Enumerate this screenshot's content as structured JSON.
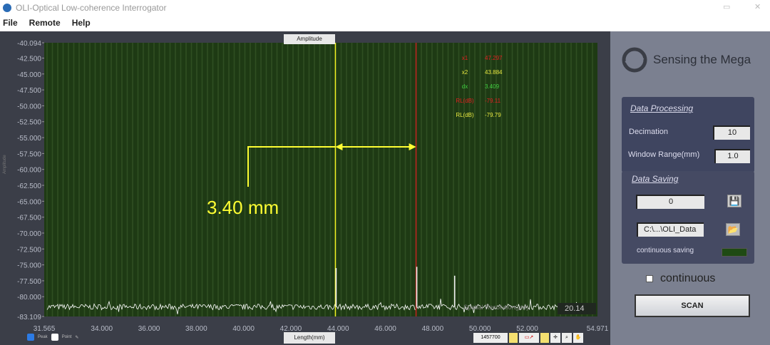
{
  "window": {
    "title": "OLI-Optical Low-coherence Interrogator",
    "minimize": "▭",
    "close": "✕"
  },
  "menu": [
    "File",
    "Remote",
    "Help"
  ],
  "plot": {
    "top_tab": "Amplitude",
    "bottom_tab": "Length(mm)",
    "y_side_label": "Amplitude",
    "legend": [
      {
        "label": "Peak",
        "checked": true
      },
      {
        "label": "Point",
        "checked": false
      }
    ],
    "toolbar_value": "1457700",
    "spatial_label": "Spatial Resolution(µm)",
    "spatial_value": "20.14",
    "annotation": "3.40 mm",
    "readouts": [
      {
        "key": "x1",
        "value": "47.297",
        "color": "#e02020"
      },
      {
        "key": "x2",
        "value": "43.884",
        "color": "#e8e840"
      },
      {
        "key": "dx",
        "value": "3.409",
        "color": "#40d040"
      },
      {
        "key": "RL(dB)",
        "value": "-79.11",
        "color": "#e02020"
      },
      {
        "key": "RL(dB)",
        "value": "-79.79",
        "color": "#e8e840"
      }
    ]
  },
  "chart_data": {
    "type": "line",
    "xlabel": "Length(mm)",
    "ylabel": "Amplitude",
    "xlim": [
      31.565,
      54.971
    ],
    "ylim": [
      -83.109,
      -40.094
    ],
    "x_ticks": [
      "31.565",
      "34.000",
      "36.000",
      "38.000",
      "40.000",
      "42.000",
      "44.000",
      "46.000",
      "48.000",
      "50.000",
      "52.000",
      "54.971"
    ],
    "y_ticks": [
      "-40.094",
      "-42.500",
      "-45.000",
      "-47.500",
      "-50.000",
      "-52.500",
      "-55.000",
      "-57.500",
      "-60.000",
      "-62.500",
      "-65.000",
      "-67.500",
      "-70.000",
      "-72.500",
      "-75.000",
      "-77.500",
      "-80.000",
      "-83.109"
    ],
    "noise_floor": -81.6,
    "peaks": [
      {
        "x": 43.884,
        "y": -75.5
      },
      {
        "x": 47.297,
        "y": -75.3
      },
      {
        "x": 48.9,
        "y": -76.7
      }
    ],
    "cursors": [
      {
        "name": "x2",
        "x": 43.884,
        "color": "#f0f020"
      },
      {
        "name": "x1",
        "x": 47.297,
        "color": "#c02020"
      }
    ],
    "grid": true,
    "background": "#1e3a14",
    "trace_color": "#ffffff"
  },
  "side": {
    "brand": "Sensing the Mega",
    "processing": {
      "title": "Data Processing",
      "decimation_label": "Decimation",
      "decimation": "10",
      "window_label": "Window Range(mm)",
      "window": "1.0"
    },
    "saving": {
      "title": "Data Saving",
      "count": "0",
      "path": "C:\\...\\OLI_Data",
      "continuous_saving_label": "continuous  saving"
    },
    "continuous_label": "continuous",
    "scan_label": "SCAN"
  }
}
